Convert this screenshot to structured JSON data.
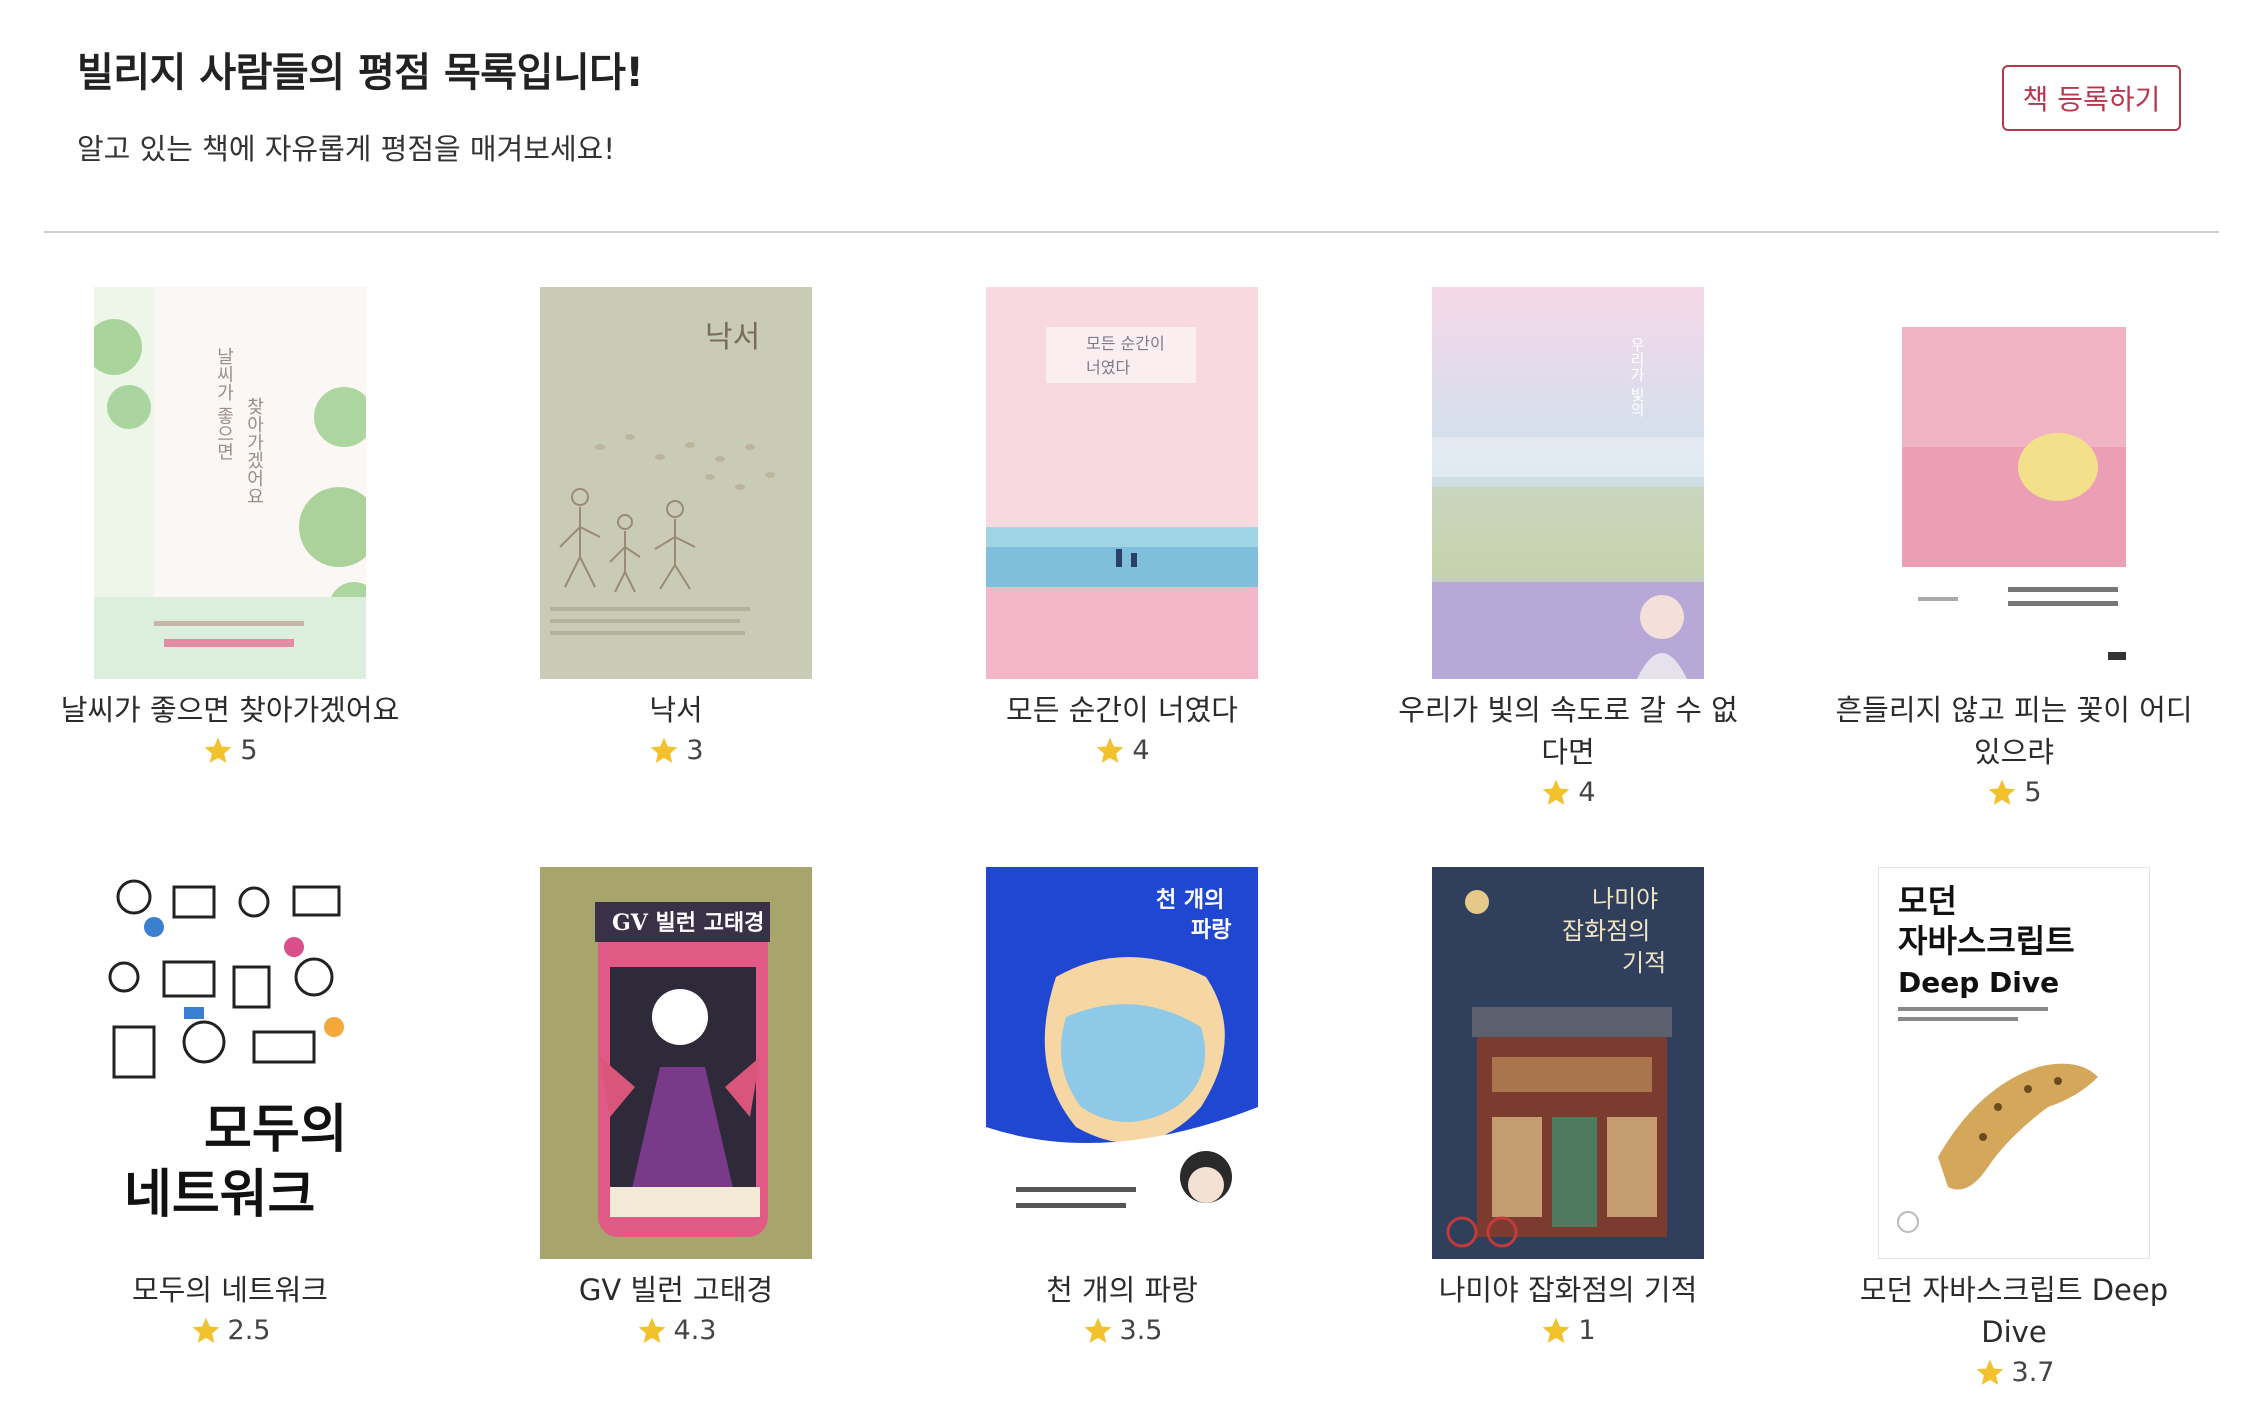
{
  "header": {
    "title": "빌리지 사람들의 평점 목록입니다!",
    "subtitle": "알고 있는 책에 자유롭게 평점을 매겨보세요!",
    "register_button": "책 등록하기"
  },
  "books": [
    {
      "title": "날씨가 좋으면 찾아가겠어요",
      "rating": "5",
      "cover_title": "날씨가 좋으면 찾아가겠어요",
      "cover_colors": [
        "#fbf7f4",
        "#dcefdc",
        "#7fbf6b"
      ]
    },
    {
      "title": "낙서",
      "rating": "3",
      "cover_title": "낙서",
      "cover_colors": [
        "#c9cbb6",
        "#b8bba3",
        "#9b8a74"
      ]
    },
    {
      "title": "모든 순간이 너였다",
      "rating": "4",
      "cover_title": "모든 순간이 너였다",
      "cover_colors": [
        "#f7d9df",
        "#9fd3e6",
        "#f3b7c9"
      ]
    },
    {
      "title": "우리가 빛의 속도로 갈 수 없다면",
      "rating": "4",
      "cover_title": "우리가 빛의 속도로 갈 수 없다면",
      "cover_colors": [
        "#f3d7e6",
        "#bfd9e8",
        "#b9a7d6"
      ]
    },
    {
      "title": "흔들리지 않고 피는 꽃이 어디 있으랴",
      "rating": "5",
      "cover_title": "흔들리지 않고 피는 꽃이 어디 있으랴",
      "cover_colors": [
        "#ffffff",
        "#e98aa3",
        "#f2e08a"
      ]
    },
    {
      "title": "모두의 네트워크",
      "rating": "2.5",
      "cover_title": "모두의 네트워크",
      "cover_colors": [
        "#ffffff",
        "#222222",
        "#3a7fd0"
      ]
    },
    {
      "title": "GV 빌런 고태경",
      "rating": "4.3",
      "cover_title": "GV 빌런 고태경",
      "cover_colors": [
        "#a7a56c",
        "#7a3a8a",
        "#d9557a"
      ]
    },
    {
      "title": "천 개의 파랑",
      "rating": "3.5",
      "cover_title": "천 개의 파랑",
      "cover_colors": [
        "#1f47d1",
        "#f6d6a2",
        "#ffffff"
      ]
    },
    {
      "title": "나미야 잡화점의 기적",
      "rating": "1",
      "cover_title": "나미야 잡화점의 기적",
      "cover_colors": [
        "#2f3f5c",
        "#7b3b2e",
        "#e4c98a"
      ]
    },
    {
      "title": "모던 자바스크립트 Deep Dive",
      "rating": "3.7",
      "cover_title": "모던 자바스크립트 Deep Dive",
      "cover_colors": [
        "#ffffff",
        "#111111",
        "#c79a4b"
      ]
    }
  ],
  "colors": {
    "accent": "#b5384f",
    "star": "#f2c12e",
    "divider": "#cfcfcf"
  }
}
